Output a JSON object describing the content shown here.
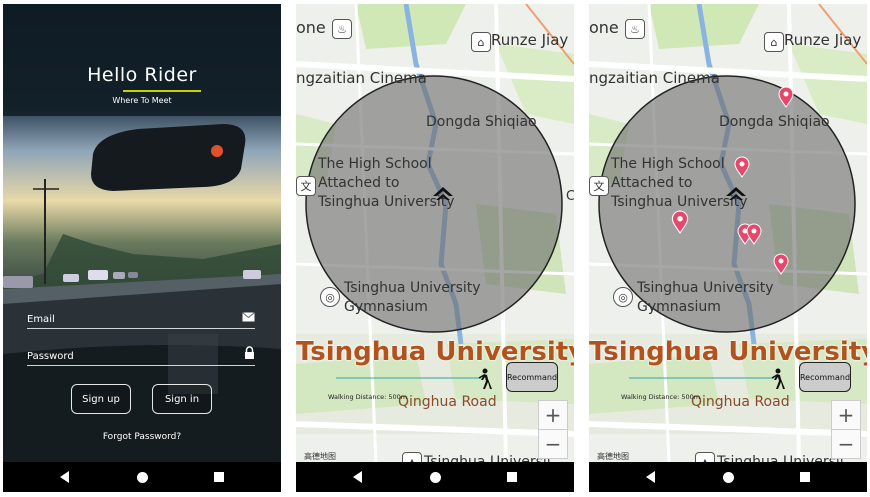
{
  "login": {
    "title": "Hello Rider",
    "subtitle": "Where To Meet",
    "email_label": "Email",
    "password_label": "Password",
    "signup_label": "Sign up",
    "signin_label": "Sign in",
    "forgot_label": "Forgot Password?",
    "accent_color": "#c8d200"
  },
  "map": {
    "labels": {
      "one": "one",
      "runze": "Runze Jiay",
      "cinema": "ngzaitian Cinema",
      "dongda": "Dongda Shiqiao",
      "highschool_1": "The High School",
      "highschool_2": "Attached to",
      "highschool_3": "Tsinghua University",
      "gym_1": "Tsinghua University",
      "gym_2": "Gymnasium",
      "campus": "Tsinghua University",
      "road": "Qinghua Road",
      "bottom": "Tsinghua Universit",
      "edge_c": "C",
      "wen": "文",
      "amap": "高德地图"
    },
    "walking_distance": "Walking Distance: 500m",
    "recommend_label": "Recommand",
    "zoom_in": "+",
    "zoom_out": "−",
    "campus_color": "#b2521c",
    "pin_color": "#e8476b"
  },
  "icons": [
    "home-icon",
    "walking-person-icon",
    "mail-icon",
    "lock-icon",
    "location-pin-icon",
    "back-icon",
    "home-nav-icon",
    "recent-apps-icon"
  ]
}
